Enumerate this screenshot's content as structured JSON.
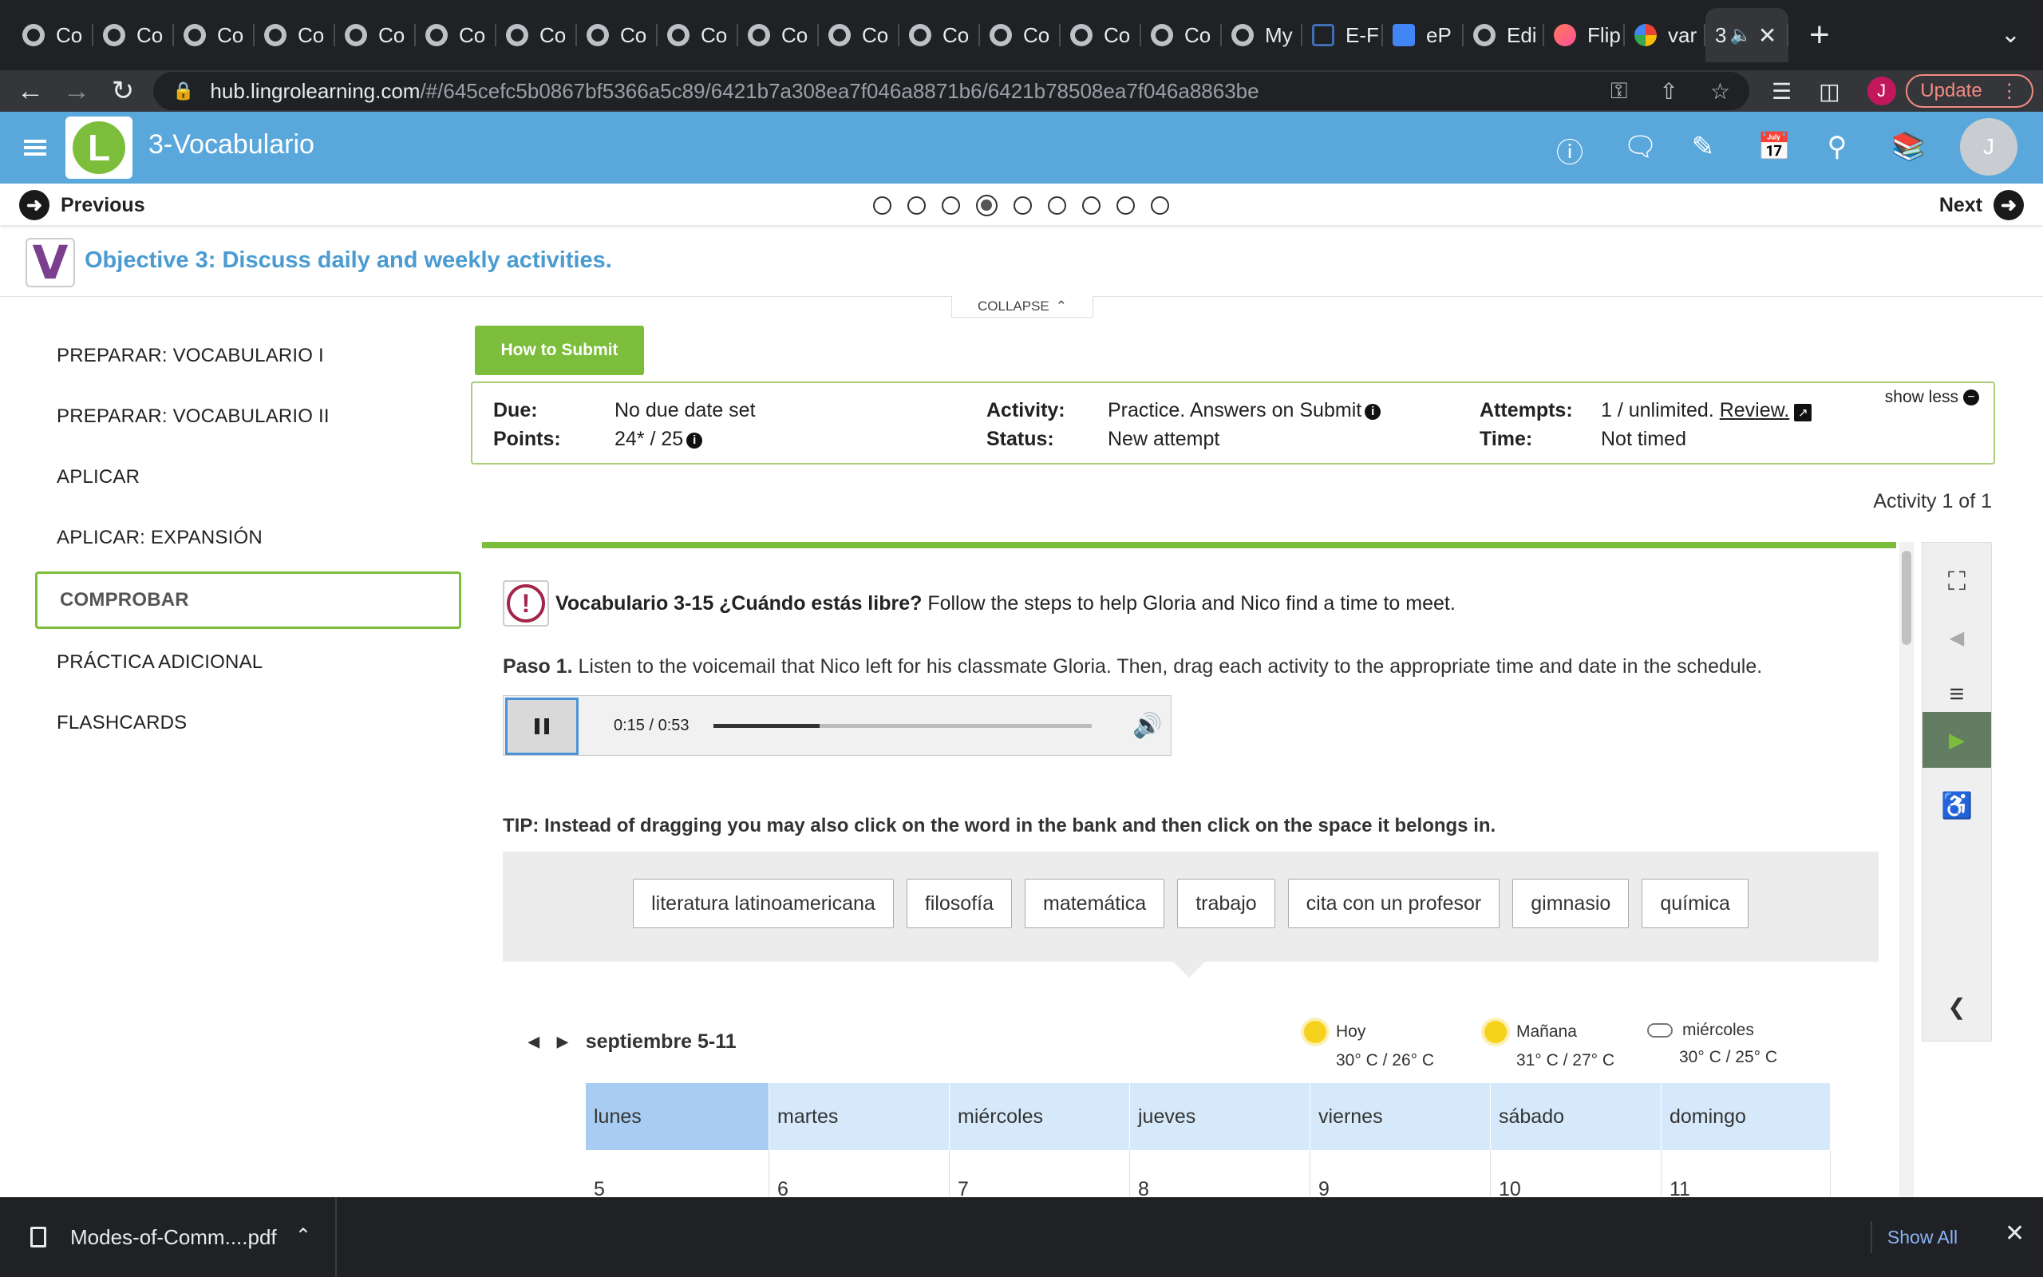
{
  "browser": {
    "tabs": [
      {
        "label": "Co",
        "icon": "globe-icon"
      },
      {
        "label": "Co",
        "icon": "globe-icon"
      },
      {
        "label": "Co",
        "icon": "globe-icon"
      },
      {
        "label": "Co",
        "icon": "globe-icon"
      },
      {
        "label": "Co",
        "icon": "globe-icon"
      },
      {
        "label": "Co",
        "icon": "globe-icon"
      },
      {
        "label": "Co",
        "icon": "globe-icon"
      },
      {
        "label": "Co",
        "icon": "globe-icon"
      },
      {
        "label": "Co",
        "icon": "globe-icon"
      },
      {
        "label": "Co",
        "icon": "globe-icon"
      },
      {
        "label": "Co",
        "icon": "globe-icon"
      },
      {
        "label": "Co",
        "icon": "globe-icon"
      },
      {
        "label": "Co",
        "icon": "globe-icon"
      },
      {
        "label": "Co",
        "icon": "globe-icon"
      },
      {
        "label": "Co",
        "icon": "globe-icon"
      },
      {
        "label": "My",
        "icon": "site-icon"
      },
      {
        "label": "E-F",
        "icon": "crown-icon"
      },
      {
        "label": "eP",
        "icon": "docs-icon"
      },
      {
        "label": "Edi",
        "icon": "globe-icon"
      },
      {
        "label": "Flip",
        "icon": "flip-icon"
      },
      {
        "label": "var",
        "icon": "google-icon"
      }
    ],
    "active_tab_label": "3",
    "new_tab": "+",
    "url_host": "hub.lingrolearning.com",
    "url_path": "/#/645cefc5b0867bf5366a5c89/6421b7a308ea7f046a8871b6/6421b78508ea7f046a8863be",
    "profile_initial": "J",
    "update_label": "Update"
  },
  "app": {
    "title": "3-Vocabulario",
    "logo_letter": "L",
    "avatar_initial": "J",
    "accent": "#5aa7dc",
    "green": "#7cbd3b"
  },
  "pager": {
    "previous": "Previous",
    "next": "Next",
    "page_count": 9,
    "current_page": 4
  },
  "objective": {
    "badge": "V",
    "text": "Objective 3: Discuss daily and weekly activities.",
    "collapse": "COLLAPSE"
  },
  "sidebar": {
    "items": [
      {
        "label": "PREPARAR: VOCABULARIO I"
      },
      {
        "label": "PREPARAR: VOCABULARIO II"
      },
      {
        "label": "APLICAR"
      },
      {
        "label": "APLICAR: EXPANSIÓN"
      },
      {
        "label": "COMPROBAR"
      },
      {
        "label": "PRÁCTICA ADICIONAL"
      },
      {
        "label": "FLASHCARDS"
      }
    ],
    "active_index": 4
  },
  "assignment": {
    "how_to_submit": "How to Submit",
    "show_less": "show less",
    "due_label": "Due:",
    "due_value": "No due date set",
    "points_label": "Points:",
    "points_value": "24* / 25",
    "activity_label": "Activity:",
    "activity_value": "Practice. Answers on Submit",
    "status_label": "Status:",
    "status_value": "New attempt",
    "attempts_label": "Attempts:",
    "attempts_value": "1 / unlimited.",
    "review_link": "Review.",
    "time_label": "Time:",
    "time_value": "Not timed",
    "activity_count": "Activity 1 of 1"
  },
  "activity": {
    "title_bold": "Vocabulario 3-15 ¿Cuándo estás libre?",
    "title_rest": "Follow the steps to help Gloria and Nico find a time to meet.",
    "paso_bold": "Paso 1.",
    "paso_text": "Listen to the voicemail that Nico left for his classmate Gloria. Then, drag each activity to the appropriate time and date in the schedule.",
    "audio_time": "0:15 / 0:53",
    "audio_progress": 0.28,
    "tip": "TIP: Instead of dragging you may also click on the word in the bank and then click on the space it belongs in.",
    "word_bank": [
      "literatura latinoamericana",
      "filosofía",
      "matemática",
      "trabajo",
      "cita con un profesor",
      "gimnasio",
      "química"
    ],
    "week_label": "septiembre 5-11",
    "weather": [
      {
        "day": "Hoy",
        "temp": "30° C / 26° C",
        "icon": "sun-icon"
      },
      {
        "day": "Mañana",
        "temp": "31° C / 27° C",
        "icon": "sun-icon"
      },
      {
        "day": "miércoles",
        "temp": "30° C / 25° C",
        "icon": "cloud-icon"
      }
    ],
    "calendar_days": [
      "lunes",
      "martes",
      "miércoles",
      "jueves",
      "viernes",
      "sábado",
      "domingo"
    ],
    "calendar_dates": [
      "5",
      "6",
      "7",
      "8",
      "9",
      "10",
      "11"
    ],
    "selected_day_index": 0
  },
  "downloads": {
    "file": "Modes-of-Comm....pdf",
    "show_all": "Show All"
  }
}
